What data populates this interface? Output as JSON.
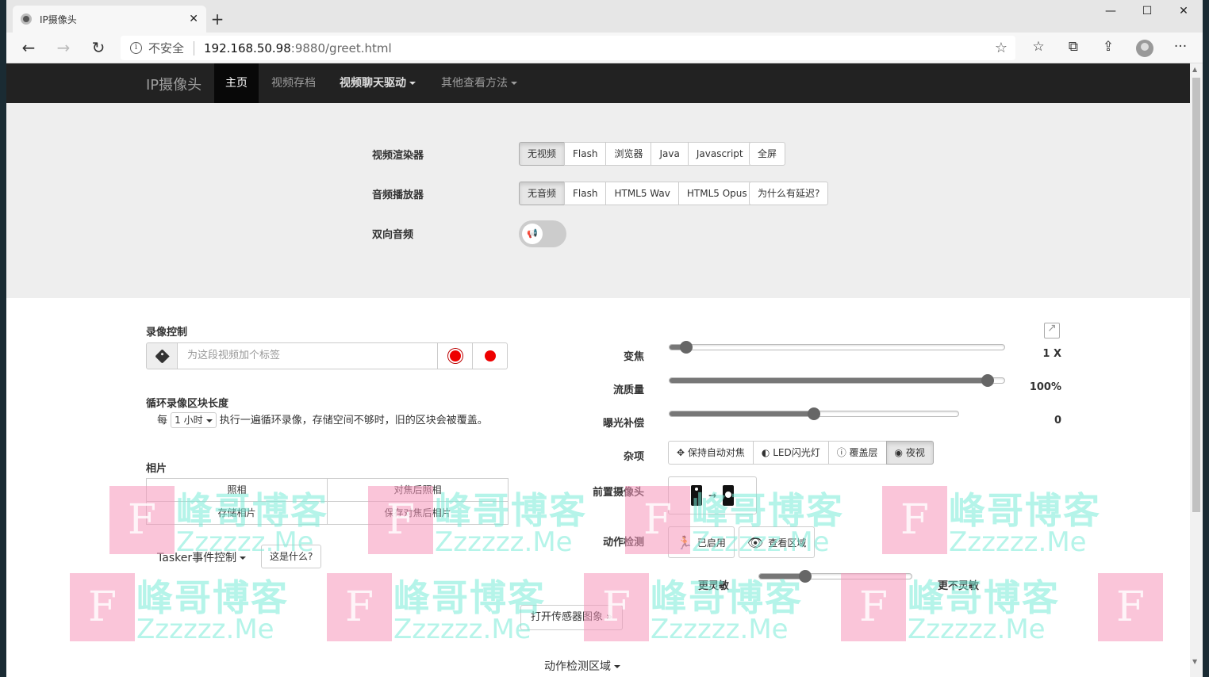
{
  "browser": {
    "tab_title": "IP摄像头",
    "tab_close": "✕",
    "new_tab": "+",
    "minimize": "—",
    "maximize": "☐",
    "close_window": "✕",
    "back": "←",
    "forward": "→",
    "refresh": "↻",
    "security_text": "不安全",
    "url_host": "192.168.50.98",
    "url_rest": ":9880/greet.html",
    "star": "☆",
    "more": "···"
  },
  "navbar": {
    "brand": "IP摄像头",
    "items": [
      {
        "label": "主页"
      },
      {
        "label": "视频存档"
      },
      {
        "label": "视频聊天驱动"
      },
      {
        "label": "其他查看方法"
      }
    ]
  },
  "renderer": {
    "label": "视频渲染器",
    "options": [
      "无视频",
      "Flash",
      "浏览器",
      "Java",
      "Javascript"
    ],
    "fullscreen": "全屏"
  },
  "audio": {
    "label": "音频播放器",
    "options": [
      "无音频",
      "Flash",
      "HTML5 Wav",
      "HTML5 Opus"
    ],
    "why_delay": "为什么有延迟?"
  },
  "two_way": {
    "label": "双向音频"
  },
  "recording": {
    "label": "录像控制",
    "placeholder": "为这段视频加个标签"
  },
  "loop": {
    "label": "循环录像区块长度",
    "prefix": "每",
    "interval": "1 小时",
    "suffix": "执行一遍循环录像，存储空间不够时，旧的区块会被覆盖。"
  },
  "photos": {
    "label": "相片",
    "take": "照相",
    "focus_take": "对焦后照相",
    "store": "存储相片",
    "store_focus": "保存对焦后相片"
  },
  "tasker": {
    "label": "Tasker事件控制",
    "what": "这是什么?"
  },
  "controls": {
    "zoom": {
      "label": "变焦",
      "value": "1 X",
      "level": 0.05
    },
    "quality": {
      "label": "流质量",
      "value": "100%",
      "level": 0.95
    },
    "exposure": {
      "label": "曝光补偿",
      "value": "0",
      "level": 0.5
    },
    "misc": {
      "label": "杂项",
      "options": [
        "保持自动对焦",
        "LED闪光灯",
        "覆盖层",
        "夜视"
      ]
    },
    "front_camera": {
      "label": "前置摄像头"
    },
    "motion": {
      "label": "动作检测",
      "enabled": "已启用",
      "view_area": "查看区域"
    },
    "sensitivity": {
      "more": "更灵敏",
      "less": "更不灵敏",
      "level": 0.3
    }
  },
  "sensor_button": "打开传感器图象 »",
  "motion_area": "动作检测区域",
  "watermark": {
    "logo": "F",
    "cn": "峰哥博客",
    "en": "Zzzzzz.Me"
  }
}
